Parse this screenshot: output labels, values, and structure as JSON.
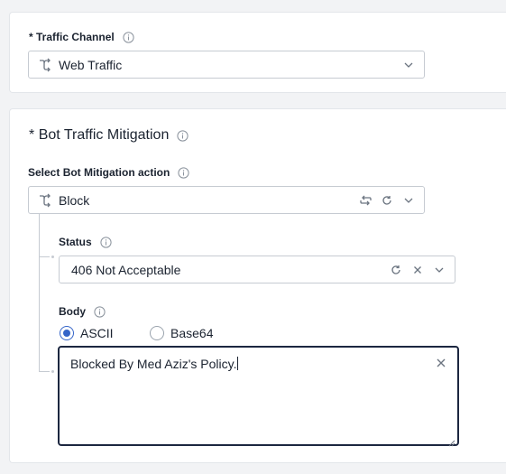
{
  "traffic_channel": {
    "required_mark": "*",
    "label": "Traffic Channel",
    "value": "Web Traffic",
    "lead_icon": "route-icon",
    "trail_icon": "chevron-down-icon"
  },
  "bot_mitigation": {
    "title_required_mark": "*",
    "title": "Bot Traffic Mitigation",
    "action": {
      "label": "Select Bot Mitigation action",
      "value": "Block",
      "icons": [
        "route-icon",
        "swap-icon",
        "reset-icon",
        "chevron-down-icon"
      ]
    },
    "status": {
      "label": "Status",
      "value": "406 Not Acceptable",
      "icons": [
        "reset-icon",
        "close-icon",
        "chevron-down-icon"
      ]
    },
    "body": {
      "label": "Body",
      "encoding_options": [
        "ASCII",
        "Base64"
      ],
      "selected_encoding": "ASCII",
      "value": "Blocked By Med Aziz's Policy."
    }
  },
  "colors": {
    "accent": "#3464c8",
    "focus_border": "#1c2740",
    "border": "#c6cbd2",
    "text": "#1b2330",
    "background": "#f2f3f5"
  }
}
